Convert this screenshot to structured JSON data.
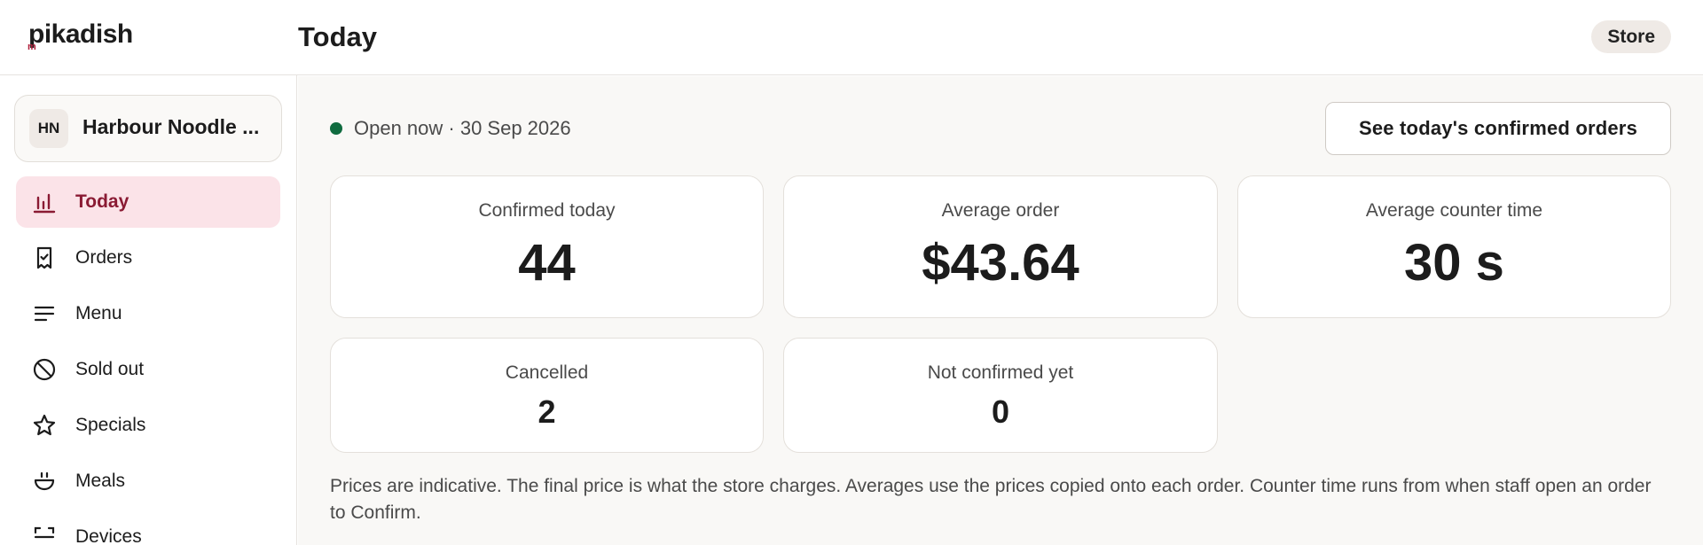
{
  "app": {
    "logo": "pikadish",
    "page_title": "Today",
    "store_button": "Store"
  },
  "sidebar": {
    "store": {
      "initials": "HN",
      "name": "Harbour Noodle ..."
    },
    "items": [
      {
        "label": "Today",
        "icon": "chart-bars-icon",
        "active": true
      },
      {
        "label": "Orders",
        "icon": "receipt-check-icon",
        "active": false
      },
      {
        "label": "Menu",
        "icon": "menu-lines-icon",
        "active": false
      },
      {
        "label": "Sold out",
        "icon": "ban-icon",
        "active": false
      },
      {
        "label": "Specials",
        "icon": "star-icon",
        "active": false
      },
      {
        "label": "Meals",
        "icon": "bowl-icon",
        "active": false
      },
      {
        "label": "Devices",
        "icon": "scan-icon",
        "active": false
      }
    ]
  },
  "main": {
    "status": "Open now · 30 Sep 2026",
    "confirmed_orders_button": "See today's confirmed orders",
    "stats": {
      "confirmed_today": {
        "label": "Confirmed today",
        "value": "44"
      },
      "average_order": {
        "label": "Average order",
        "value": "$43.64"
      },
      "average_counter_time": {
        "label": "Average counter time",
        "value": "30 s"
      },
      "cancelled": {
        "label": "Cancelled",
        "value": "2"
      },
      "not_confirmed": {
        "label": "Not confirmed yet",
        "value": "0"
      }
    },
    "footnote": "Prices are indicative. The final price is what the store charges. Averages use the prices copied onto each order. Counter time runs from when staff open an order to Confirm."
  },
  "colors": {
    "accent": "#8a1a33",
    "active_bg": "#fbe3e8",
    "open_dot": "#0f6b3f",
    "logo_mark": "#b0203c"
  }
}
